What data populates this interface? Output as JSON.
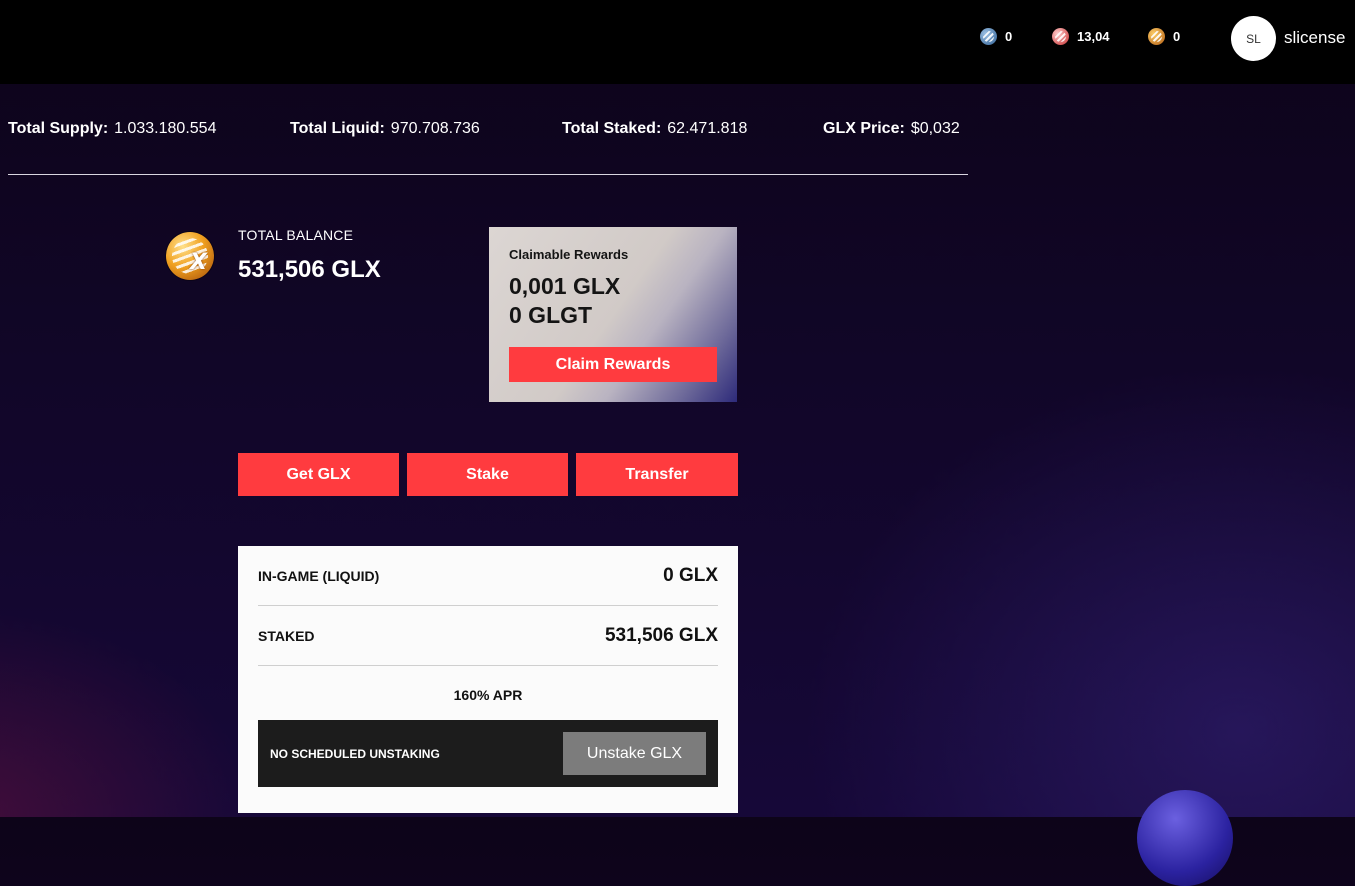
{
  "header": {
    "tokens": [
      {
        "icon": "blue-coin-icon",
        "value": "0"
      },
      {
        "icon": "red-coin-icon",
        "value": "13,04"
      },
      {
        "icon": "gold-coin-icon",
        "value": "0"
      }
    ],
    "avatar_initials": "SL",
    "username": "slicense"
  },
  "stats": {
    "total_supply_label": "Total Supply:",
    "total_supply_value": "1.033.180.554",
    "total_liquid_label": "Total Liquid:",
    "total_liquid_value": "970.708.736",
    "total_staked_label": "Total Staked:",
    "total_staked_value": "62.471.818",
    "price_label": "GLX Price:",
    "price_value": "$0,032"
  },
  "balance": {
    "label": "TOTAL BALANCE",
    "value": "531,506 GLX"
  },
  "claim": {
    "title": "Claimable Rewards",
    "glx": "0,001 GLX",
    "glgt": "0 GLGT",
    "button": "Claim Rewards"
  },
  "actions": {
    "get": "Get GLX",
    "stake": "Stake",
    "transfer": "Transfer"
  },
  "panel": {
    "liquid_label": "IN-GAME (LIQUID)",
    "liquid_value": "0 GLX",
    "staked_label": "STAKED",
    "staked_value": "531,506 GLX",
    "apr": "160% APR",
    "unstake_msg": "NO SCHEDULED UNSTAKING",
    "unstake_button": "Unstake GLX"
  },
  "colors": {
    "accent": "#ff3b3f",
    "topbar": "#000000",
    "background": "#120630"
  }
}
